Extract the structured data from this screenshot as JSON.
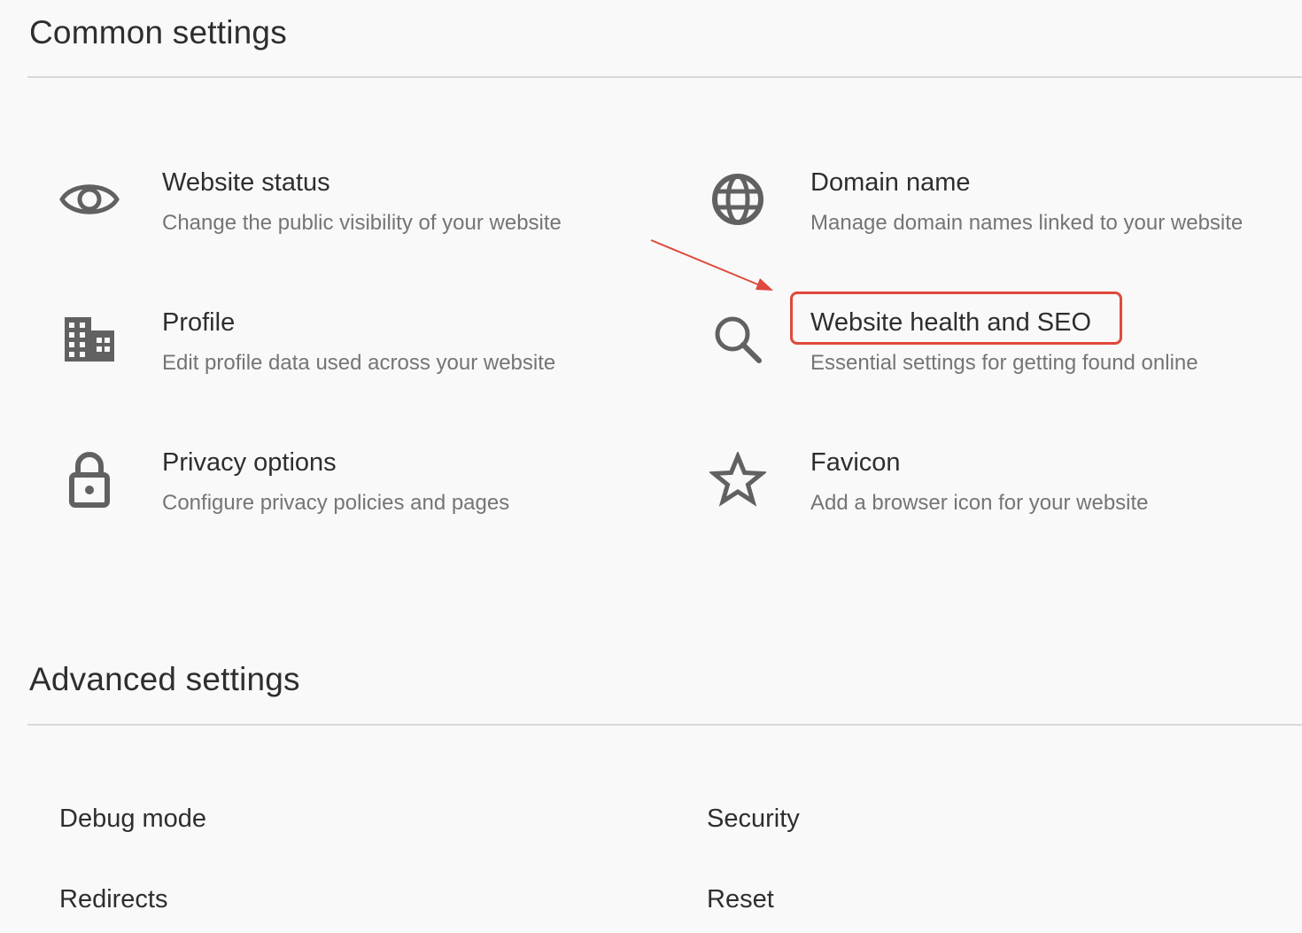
{
  "common": {
    "title": "Common settings",
    "items": [
      {
        "icon": "eye-icon",
        "title": "Website status",
        "desc": "Change the public visibility of your website"
      },
      {
        "icon": "globe-icon",
        "title": "Domain name",
        "desc": "Manage domain names linked to your website"
      },
      {
        "icon": "building-icon",
        "title": "Profile",
        "desc": "Edit profile data used across your website"
      },
      {
        "icon": "search-icon",
        "title": "Website health and SEO",
        "desc": "Essential settings for getting found online"
      },
      {
        "icon": "lock-icon",
        "title": "Privacy options",
        "desc": "Configure privacy policies and pages"
      },
      {
        "icon": "star-icon",
        "title": "Favicon",
        "desc": "Add a browser icon for your website"
      }
    ]
  },
  "advanced": {
    "title": "Advanced settings",
    "items": [
      {
        "label": "Debug mode"
      },
      {
        "label": "Security"
      },
      {
        "label": "Redirects"
      },
      {
        "label": "Reset"
      }
    ]
  },
  "annotation": {
    "color": "#e0493c",
    "highlighted_item": "Website health and SEO"
  },
  "colors": {
    "background": "#f9f9f9",
    "icon": "#616161",
    "title": "#2e2e2e",
    "description": "#757575",
    "divider": "#d9d9d9"
  }
}
